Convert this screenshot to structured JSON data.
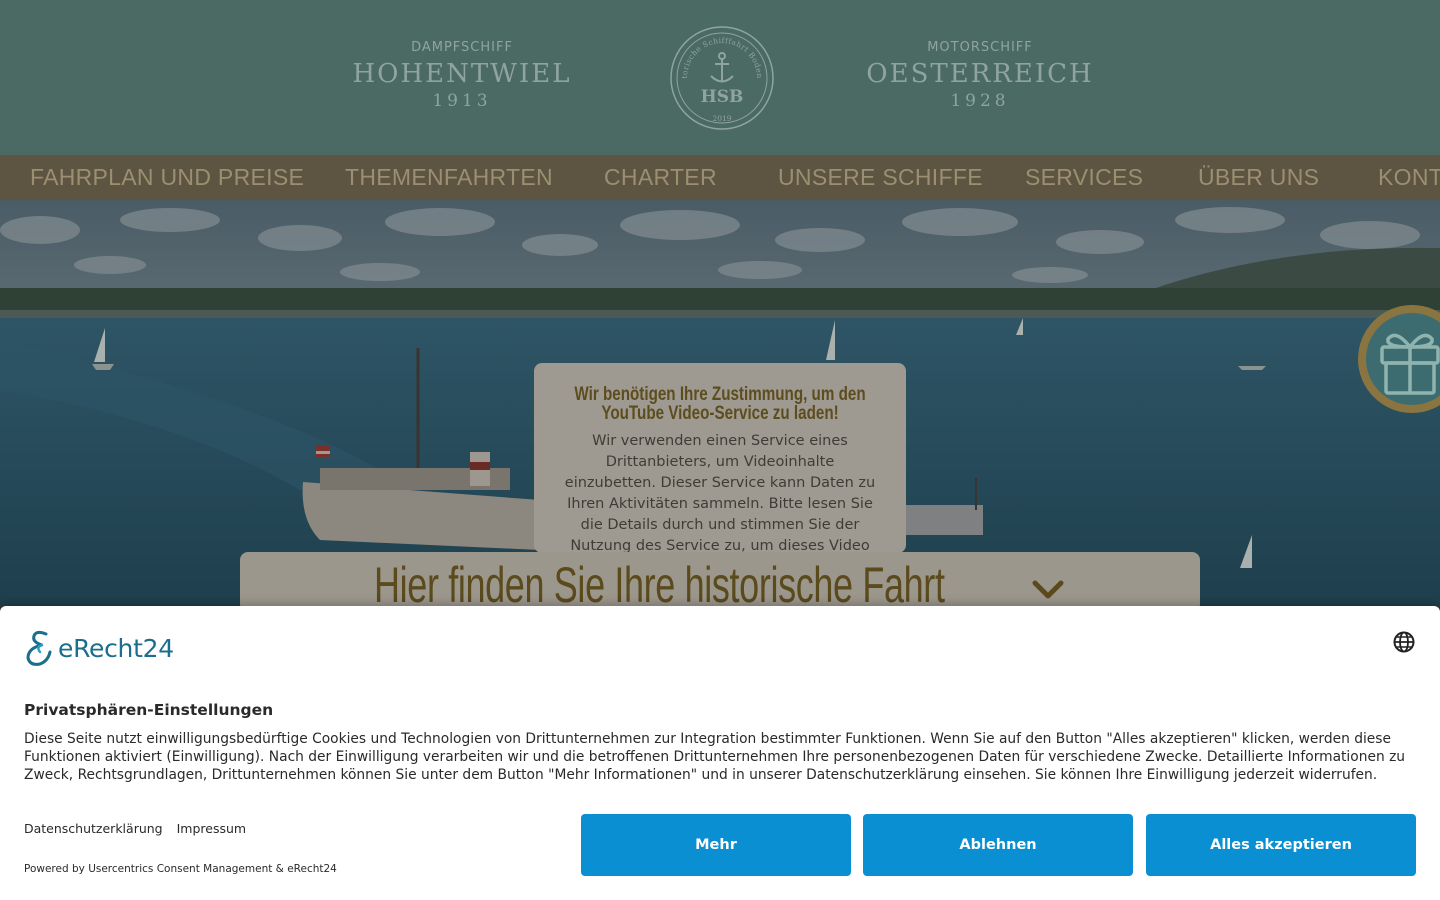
{
  "header": {
    "left_ship": {
      "kind": "DAMPFSCHIFF",
      "name": "HOHENTWIEL",
      "year": "1913"
    },
    "right_ship": {
      "kind": "MOTORSCHIFF",
      "name": "OESTERREICH",
      "year": "1928"
    },
    "seal": {
      "ring_text": "Historische Schifffahrt Bodensee",
      "initials": "HSB",
      "year": "2019"
    }
  },
  "nav": {
    "items": [
      "FAHRPLAN UND PREISE",
      "THEMENFAHRTEN",
      "CHARTER",
      "UNSERE SCHIFFE",
      "SERVICES",
      "ÜBER UNS",
      "KONTA"
    ]
  },
  "video_consent": {
    "title": "Wir benötigen Ihre Zustimmung, um den YouTube Video-Service zu laden!",
    "text": "Wir verwenden einen Service eines Drittanbieters, um Videoinhalte einzubetten. Dieser Service kann Daten zu Ihren Aktivitäten sammeln. Bitte lesen Sie die Details durch und stimmen Sie der Nutzung des Service zu, um dieses Video anzusehen."
  },
  "search": {
    "title": "Hier finden Sie Ihre historische Fahrt",
    "icon": "chevron-down-icon"
  },
  "gift": {
    "icon": "gift-icon"
  },
  "cookie_banner": {
    "logo_text": "eRecht24",
    "title": "Privatsphären-Einstellungen",
    "text": "Diese Seite nutzt einwilligungsbedürftige Cookies und Technologien von Drittunternehmen zur Integration bestimmter Funktionen. Wenn Sie auf den Button \"Alles akzeptieren\" klicken, werden diese Funktionen aktiviert (Einwilligung). Nach der Einwilligung verarbeiten wir und die betroffenen Drittunternehmen Ihre personenbezogenen Daten für verschiedene Zwecke. Detaillierte Informationen zu Zweck, Rechtsgrundlagen, Drittunternehmen können Sie unter dem Button \"Mehr Informationen\" und in unserer Datenschutzerklärung einsehen. Sie können Ihre Einwilligung jederzeit widerrufen.",
    "links": {
      "privacy": "Datenschutzerklärung",
      "imprint": "Impressum"
    },
    "powered_by": "Powered by Usercentrics Consent Management & eRecht24",
    "buttons": {
      "more": "Mehr",
      "deny": "Ablehnen",
      "accept": "Alles akzeptieren"
    },
    "button_color": "#0a8fd2"
  }
}
